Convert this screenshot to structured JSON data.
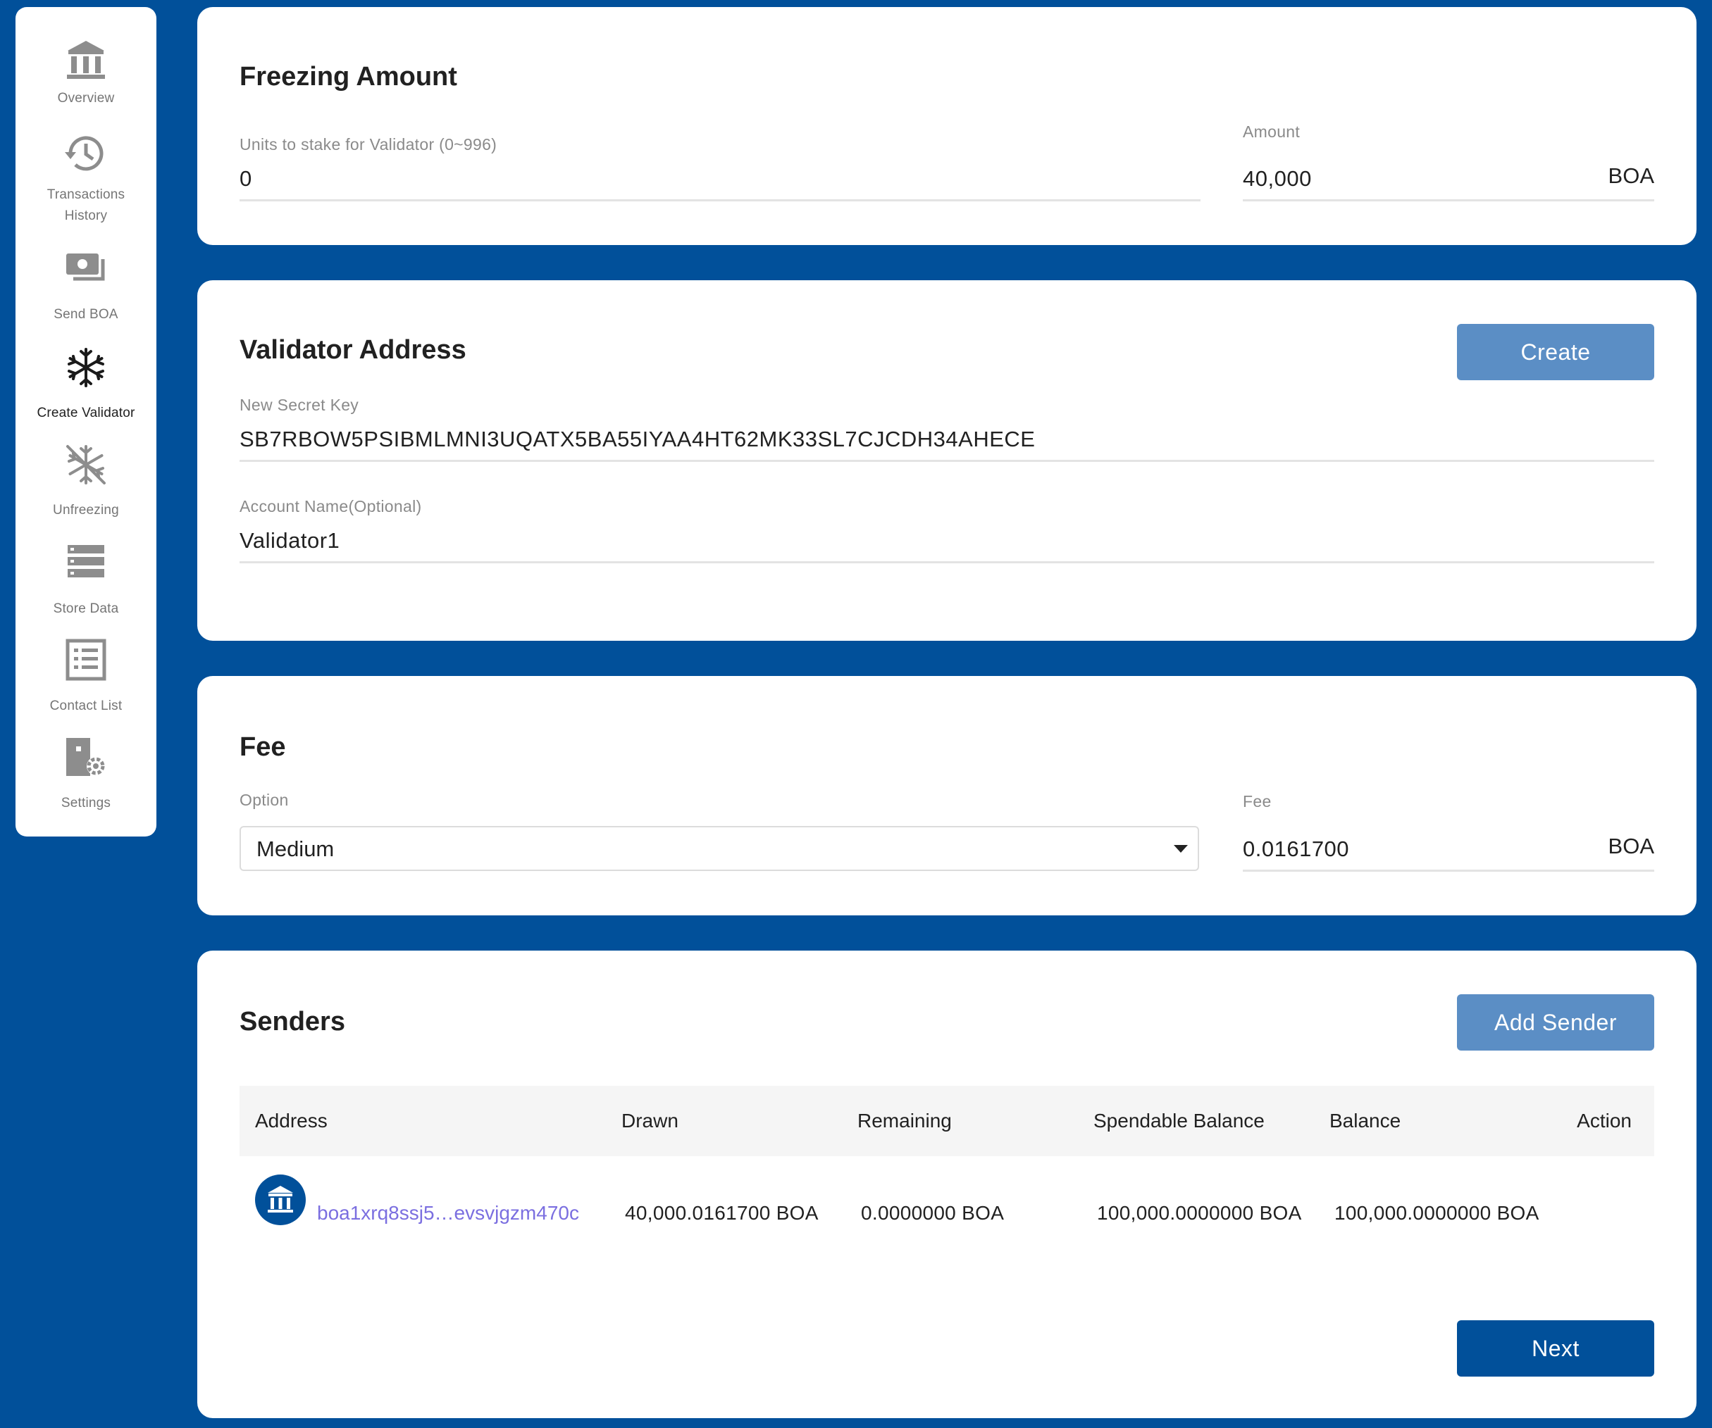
{
  "sidebar": {
    "items": [
      {
        "label": "Overview",
        "icon": "bank-icon"
      },
      {
        "label": "Transactions\nHistory",
        "icon": "history-icon"
      },
      {
        "label": "Send BOA",
        "icon": "money-icon"
      },
      {
        "label": "Create Validator",
        "icon": "snowflake-icon",
        "active": true
      },
      {
        "label": "Unfreezing",
        "icon": "snowflake-off-icon"
      },
      {
        "label": "Store Data",
        "icon": "storage-icon"
      },
      {
        "label": "Contact List",
        "icon": "list-icon"
      },
      {
        "label": "Settings",
        "icon": "settings-icon"
      }
    ]
  },
  "freezing": {
    "title": "Freezing Amount",
    "units_label": "Units to stake for Validator (0~996)",
    "units_value": "0",
    "amount_label": "Amount",
    "amount_value": "40,000",
    "amount_unit": "BOA"
  },
  "validator": {
    "title": "Validator Address",
    "create_label": "Create",
    "secret_label": "New Secret Key",
    "secret_value": "SB7RBOW5PSIBMLMNI3UQATX5BA55IYAA4HT62MK33SL7CJCDH34AHECE",
    "name_label": "Account Name(Optional)",
    "name_value": "Validator1"
  },
  "fee": {
    "title": "Fee",
    "option_label": "Option",
    "option_value": "Medium",
    "fee_label": "Fee",
    "fee_value": "0.0161700",
    "fee_unit": "BOA"
  },
  "senders": {
    "title": "Senders",
    "add_label": "Add Sender",
    "columns": [
      "Address",
      "Drawn",
      "Remaining",
      "Spendable Balance",
      "Balance",
      "Action"
    ],
    "rows": [
      {
        "address": "boa1xrq8ssj5…evsvjgzm470c",
        "drawn": "40,000.0161700 BOA",
        "remaining": "0.0000000 BOA",
        "spendable": "100,000.0000000 BOA",
        "balance": "100,000.0000000 BOA"
      }
    ],
    "next_label": "Next"
  },
  "colors": {
    "background": "#01509a",
    "button_light": "#5b8ec5",
    "button_primary": "#01509a",
    "link": "#7b6fe0"
  }
}
